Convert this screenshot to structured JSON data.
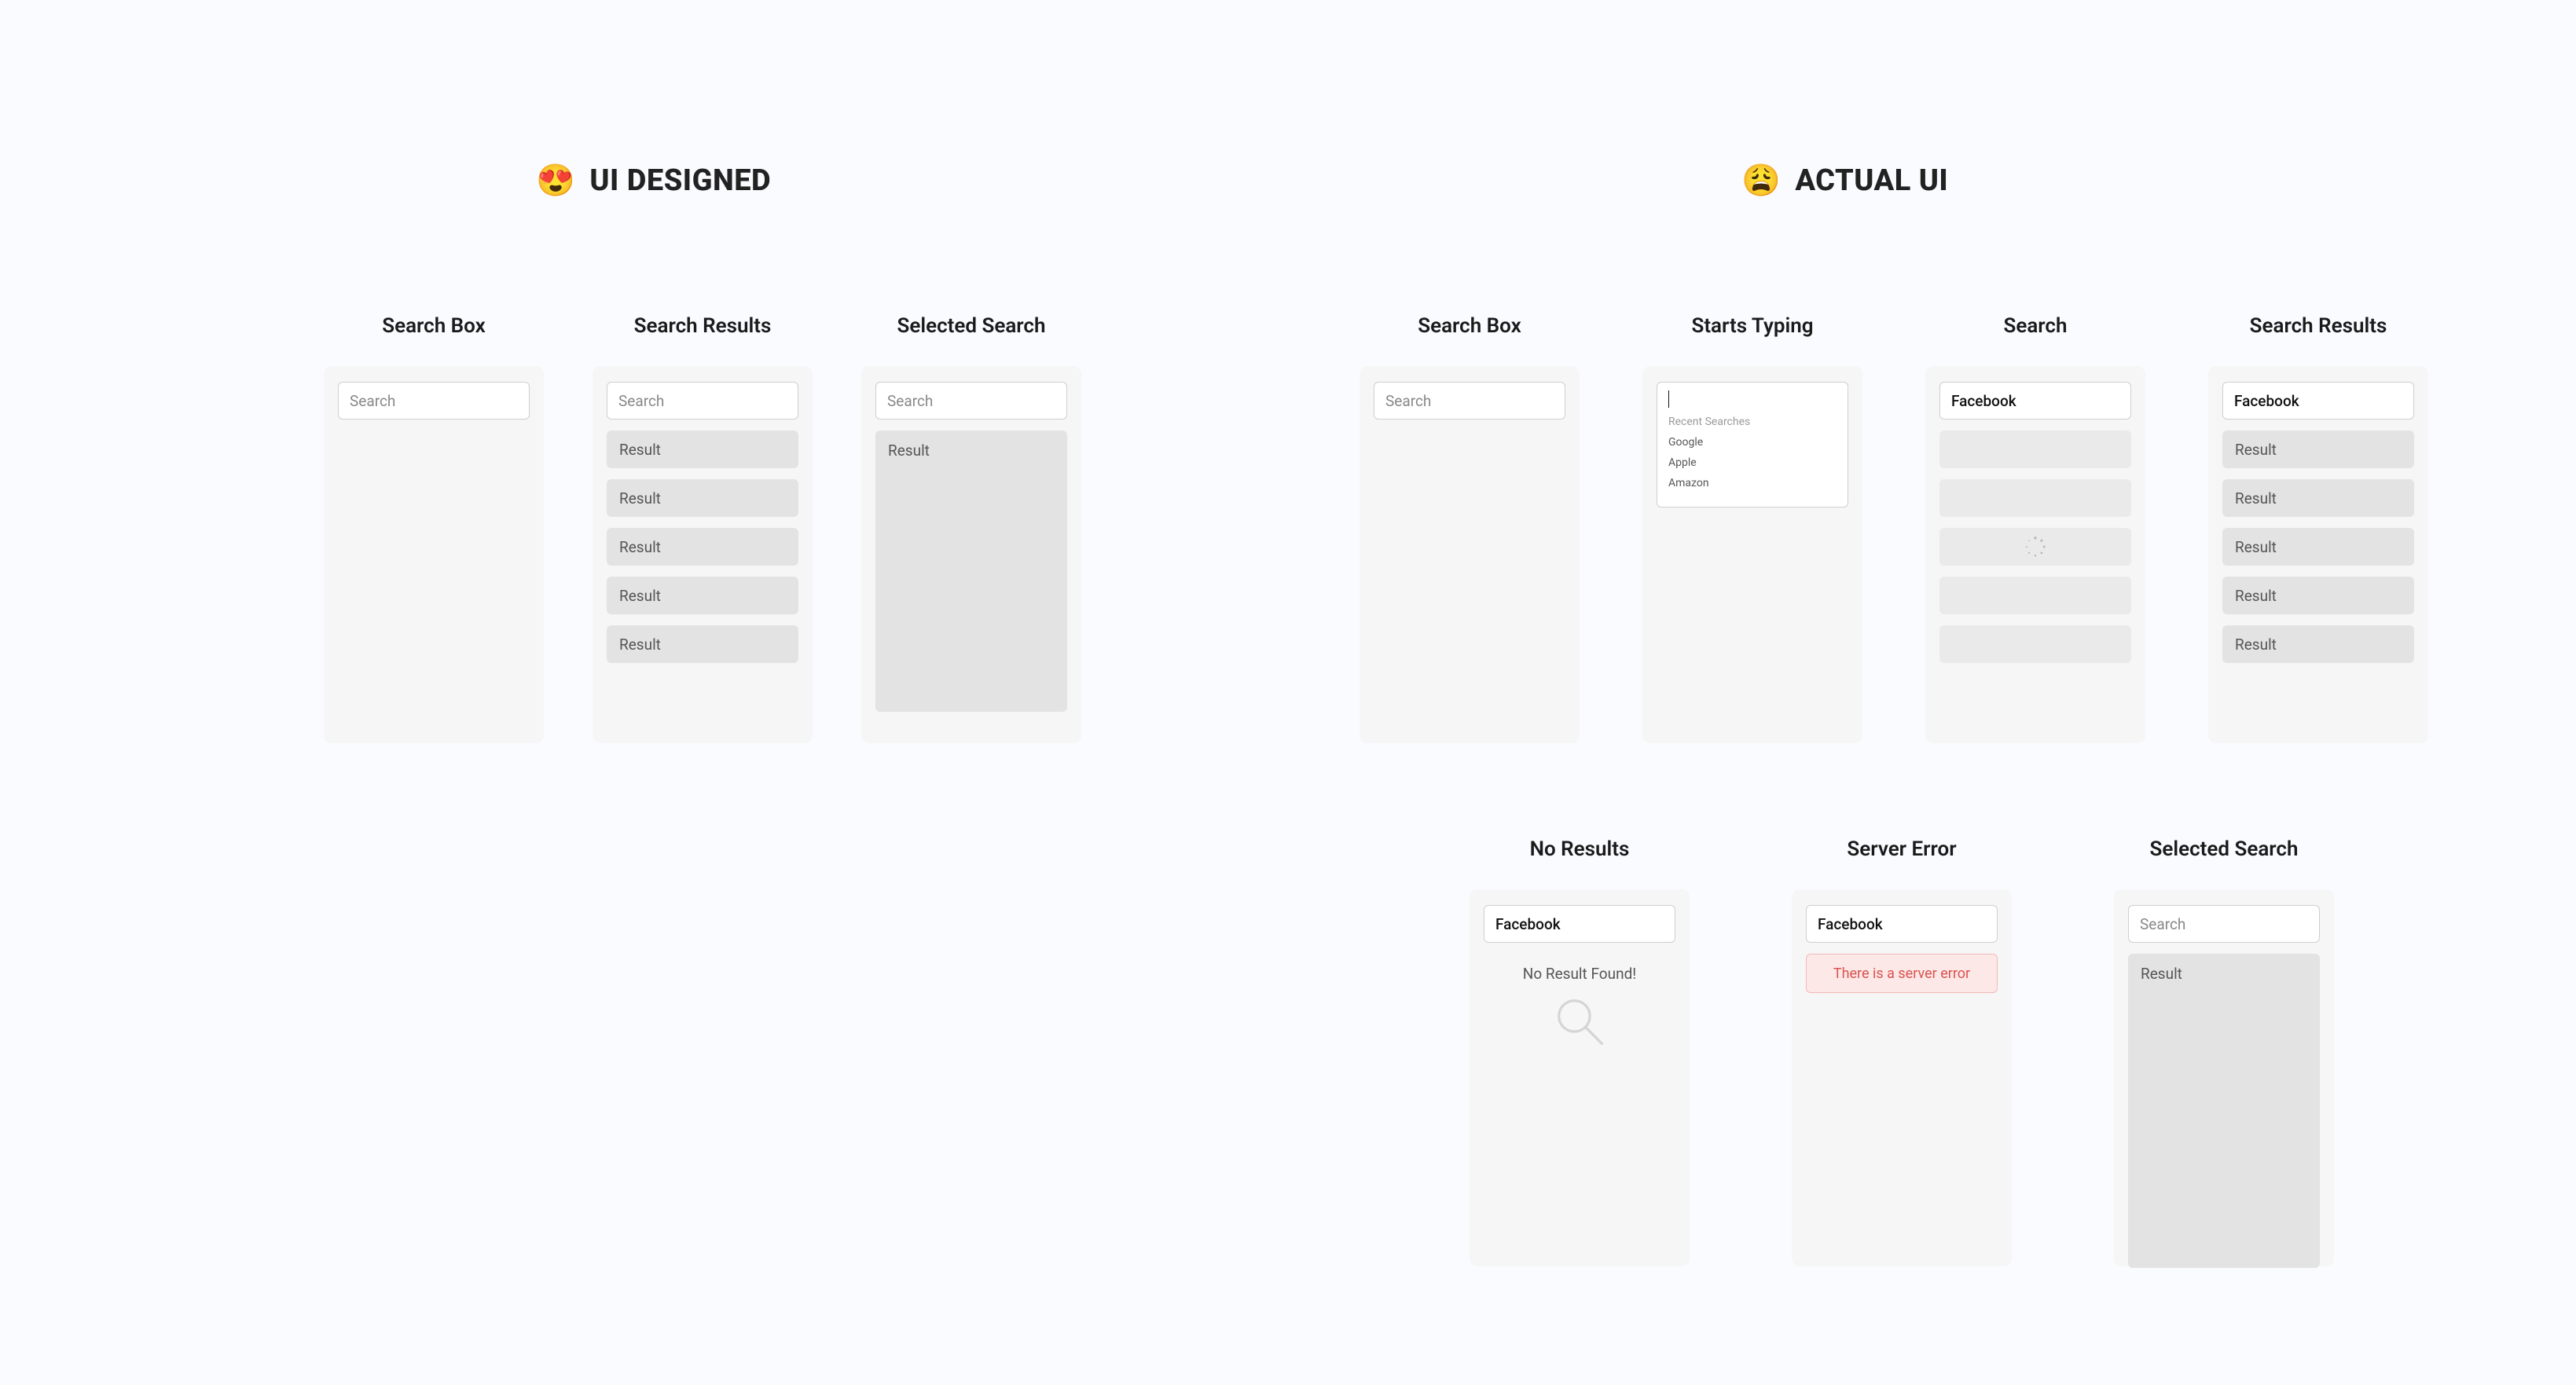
{
  "left": {
    "title": "UI DESIGNED",
    "emoji": "😍",
    "states": {
      "search_box": {
        "label": "Search Box",
        "placeholder": "Search"
      },
      "search_results": {
        "label": "Search Results",
        "placeholder": "Search",
        "items": [
          "Result",
          "Result",
          "Result",
          "Result",
          "Result"
        ]
      },
      "selected": {
        "label": "Selected Search",
        "placeholder": "Search",
        "result_label": "Result"
      }
    }
  },
  "right": {
    "title": "ACTUAL UI",
    "emoji": "😩",
    "row1": {
      "search_box": {
        "label": "Search Box",
        "placeholder": "Search"
      },
      "typing": {
        "label": "Starts Typing",
        "recent_heading": "Recent Searches",
        "recent": [
          "Google",
          "Apple",
          "Amazon"
        ]
      },
      "search": {
        "label": "Search",
        "value": "Facebook"
      },
      "results": {
        "label": "Search Results",
        "value": "Facebook",
        "items": [
          "Result",
          "Result",
          "Result",
          "Result",
          "Result"
        ]
      }
    },
    "row2": {
      "no_results": {
        "label": "No Results",
        "value": "Facebook",
        "message": "No Result Found!"
      },
      "server_error": {
        "label": "Server Error",
        "value": "Facebook",
        "message": "There is a server error"
      },
      "selected": {
        "label": "Selected Search",
        "placeholder": "Search",
        "result_label": "Result"
      }
    }
  }
}
